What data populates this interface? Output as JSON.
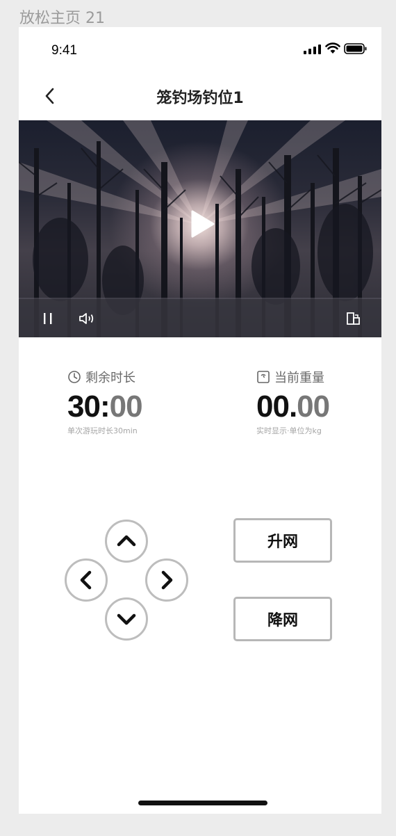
{
  "artboard": {
    "title": "放松主页 21"
  },
  "status_bar": {
    "time": "9:41"
  },
  "nav": {
    "title": "笼钓场钓位1"
  },
  "stats": {
    "remaining": {
      "label": "剩余时长",
      "value_main": "30:",
      "value_decimal": "00",
      "note": "单次游玩时长30min"
    },
    "weight": {
      "label": "当前重量",
      "value_main": "00.",
      "value_decimal": "00",
      "note": "实时显示·单位为kg"
    }
  },
  "controls": {
    "raise_net": "升网",
    "lower_net": "降网"
  },
  "icons": {
    "back": "chevron-left-icon",
    "play": "play-icon",
    "pause": "pause-icon",
    "volume": "volume-icon",
    "fullscreen": "fullscreen-icon",
    "clock": "clock-icon",
    "scale": "scale-icon",
    "up": "arrow-up-icon",
    "down": "arrow-down-icon",
    "left": "arrow-left-icon",
    "right": "arrow-right-icon"
  }
}
